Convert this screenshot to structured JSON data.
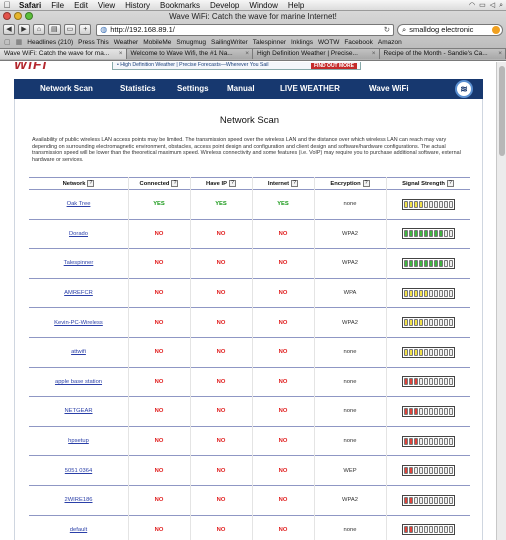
{
  "menubar": {
    "items": [
      "Safari",
      "File",
      "Edit",
      "View",
      "History",
      "Bookmarks",
      "Develop",
      "Window",
      "Help"
    ]
  },
  "window": {
    "title": "Wave WiFi: Catch the wave for marine Internet!"
  },
  "toolbar": {
    "url": "http://192.168.89.1/",
    "search_value": "smalldog electronic"
  },
  "bookmarks": [
    "Headlines (210)",
    "Press This",
    "Weather",
    "MobileMe",
    "Smugmug",
    "SailingWriter",
    "Talespinner",
    "Inklings",
    "WOTW",
    "Facebook",
    "Amazon"
  ],
  "tabs": [
    "Wave WiFi: Catch the wave for ma...",
    "Welcome to Wave Wifi, the #1 Na...",
    "High Definition Weather | Precise...",
    "Recipe of the Month - Sandie's Ca..."
  ],
  "banner": {
    "logo": "WiFi",
    "ad": "• High Definition Weather | Precise Forecasts—Wherever You Sail",
    "ad_cta": "FIND OUT MORE"
  },
  "nav": {
    "items": [
      "Network Scan",
      "Statistics",
      "Settings",
      "Manual",
      "LIVE WEATHER",
      "Wave WiFi"
    ]
  },
  "page": {
    "heading": "Network Scan",
    "disclaimer": "Availability of public wireless LAN access points may be limited. The transmission speed over the wireless LAN and the distance over which wireless LAN can reach may vary depending on surrounding electromagnetic environment, obstacles, access point design and configuration and client design and software/hardware configurations. The actual transmission speed will be lower than the theoretical maximum speed. Wireless connectivity and some features (i.e. VoIP) may require you to purchase additional software, external hardware or services."
  },
  "table": {
    "columns": [
      "Network",
      "Connected",
      "Have IP",
      "Internet",
      "Encryption",
      "Signal Strength"
    ],
    "help_mark": "?",
    "rows": [
      {
        "network": "Oak Tree",
        "connected": "YES",
        "have_ip": "YES",
        "internet": "YES",
        "encryption": "none",
        "signal": 4,
        "level": "yellow"
      },
      {
        "network": "Dorado",
        "connected": "NO",
        "have_ip": "NO",
        "internet": "NO",
        "encryption": "WPA2",
        "signal": 8,
        "level": "green"
      },
      {
        "network": "Talespinner",
        "connected": "NO",
        "have_ip": "NO",
        "internet": "NO",
        "encryption": "WPA2",
        "signal": 8,
        "level": "green"
      },
      {
        "network": "AMREFCR",
        "connected": "NO",
        "have_ip": "NO",
        "internet": "NO",
        "encryption": "WPA",
        "signal": 5,
        "level": "yellow"
      },
      {
        "network": "Kevin-PC-Wireless",
        "connected": "NO",
        "have_ip": "NO",
        "internet": "NO",
        "encryption": "WPA2",
        "signal": 4,
        "level": "yellow"
      },
      {
        "network": "attwifi",
        "connected": "NO",
        "have_ip": "NO",
        "internet": "NO",
        "encryption": "none",
        "signal": 4,
        "level": "yellow"
      },
      {
        "network": "apple base station",
        "connected": "NO",
        "have_ip": "NO",
        "internet": "NO",
        "encryption": "none",
        "signal": 3,
        "level": "red"
      },
      {
        "network": "NETGEAR",
        "connected": "NO",
        "have_ip": "NO",
        "internet": "NO",
        "encryption": "none",
        "signal": 3,
        "level": "red"
      },
      {
        "network": "hpsetup",
        "connected": "NO",
        "have_ip": "NO",
        "internet": "NO",
        "encryption": "none",
        "signal": 3,
        "level": "red"
      },
      {
        "network": "5051 0364",
        "connected": "NO",
        "have_ip": "NO",
        "internet": "NO",
        "encryption": "WEP",
        "signal": 2,
        "level": "red"
      },
      {
        "network": "2WIRE186",
        "connected": "NO",
        "have_ip": "NO",
        "internet": "NO",
        "encryption": "WPA2",
        "signal": 2,
        "level": "red"
      },
      {
        "network": "default",
        "connected": "NO",
        "have_ip": "NO",
        "internet": "NO",
        "encryption": "none",
        "signal": 2,
        "level": "red"
      }
    ],
    "signal_segments": 10
  },
  "colors": {
    "nav_bg": "#17386f",
    "yes": "#1a9a1a",
    "no": "#e01a1a",
    "link": "#2a3fa8",
    "signal_green": "#3fb53f",
    "signal_yellow": "#f3e24a",
    "signal_red": "#e0433b"
  }
}
